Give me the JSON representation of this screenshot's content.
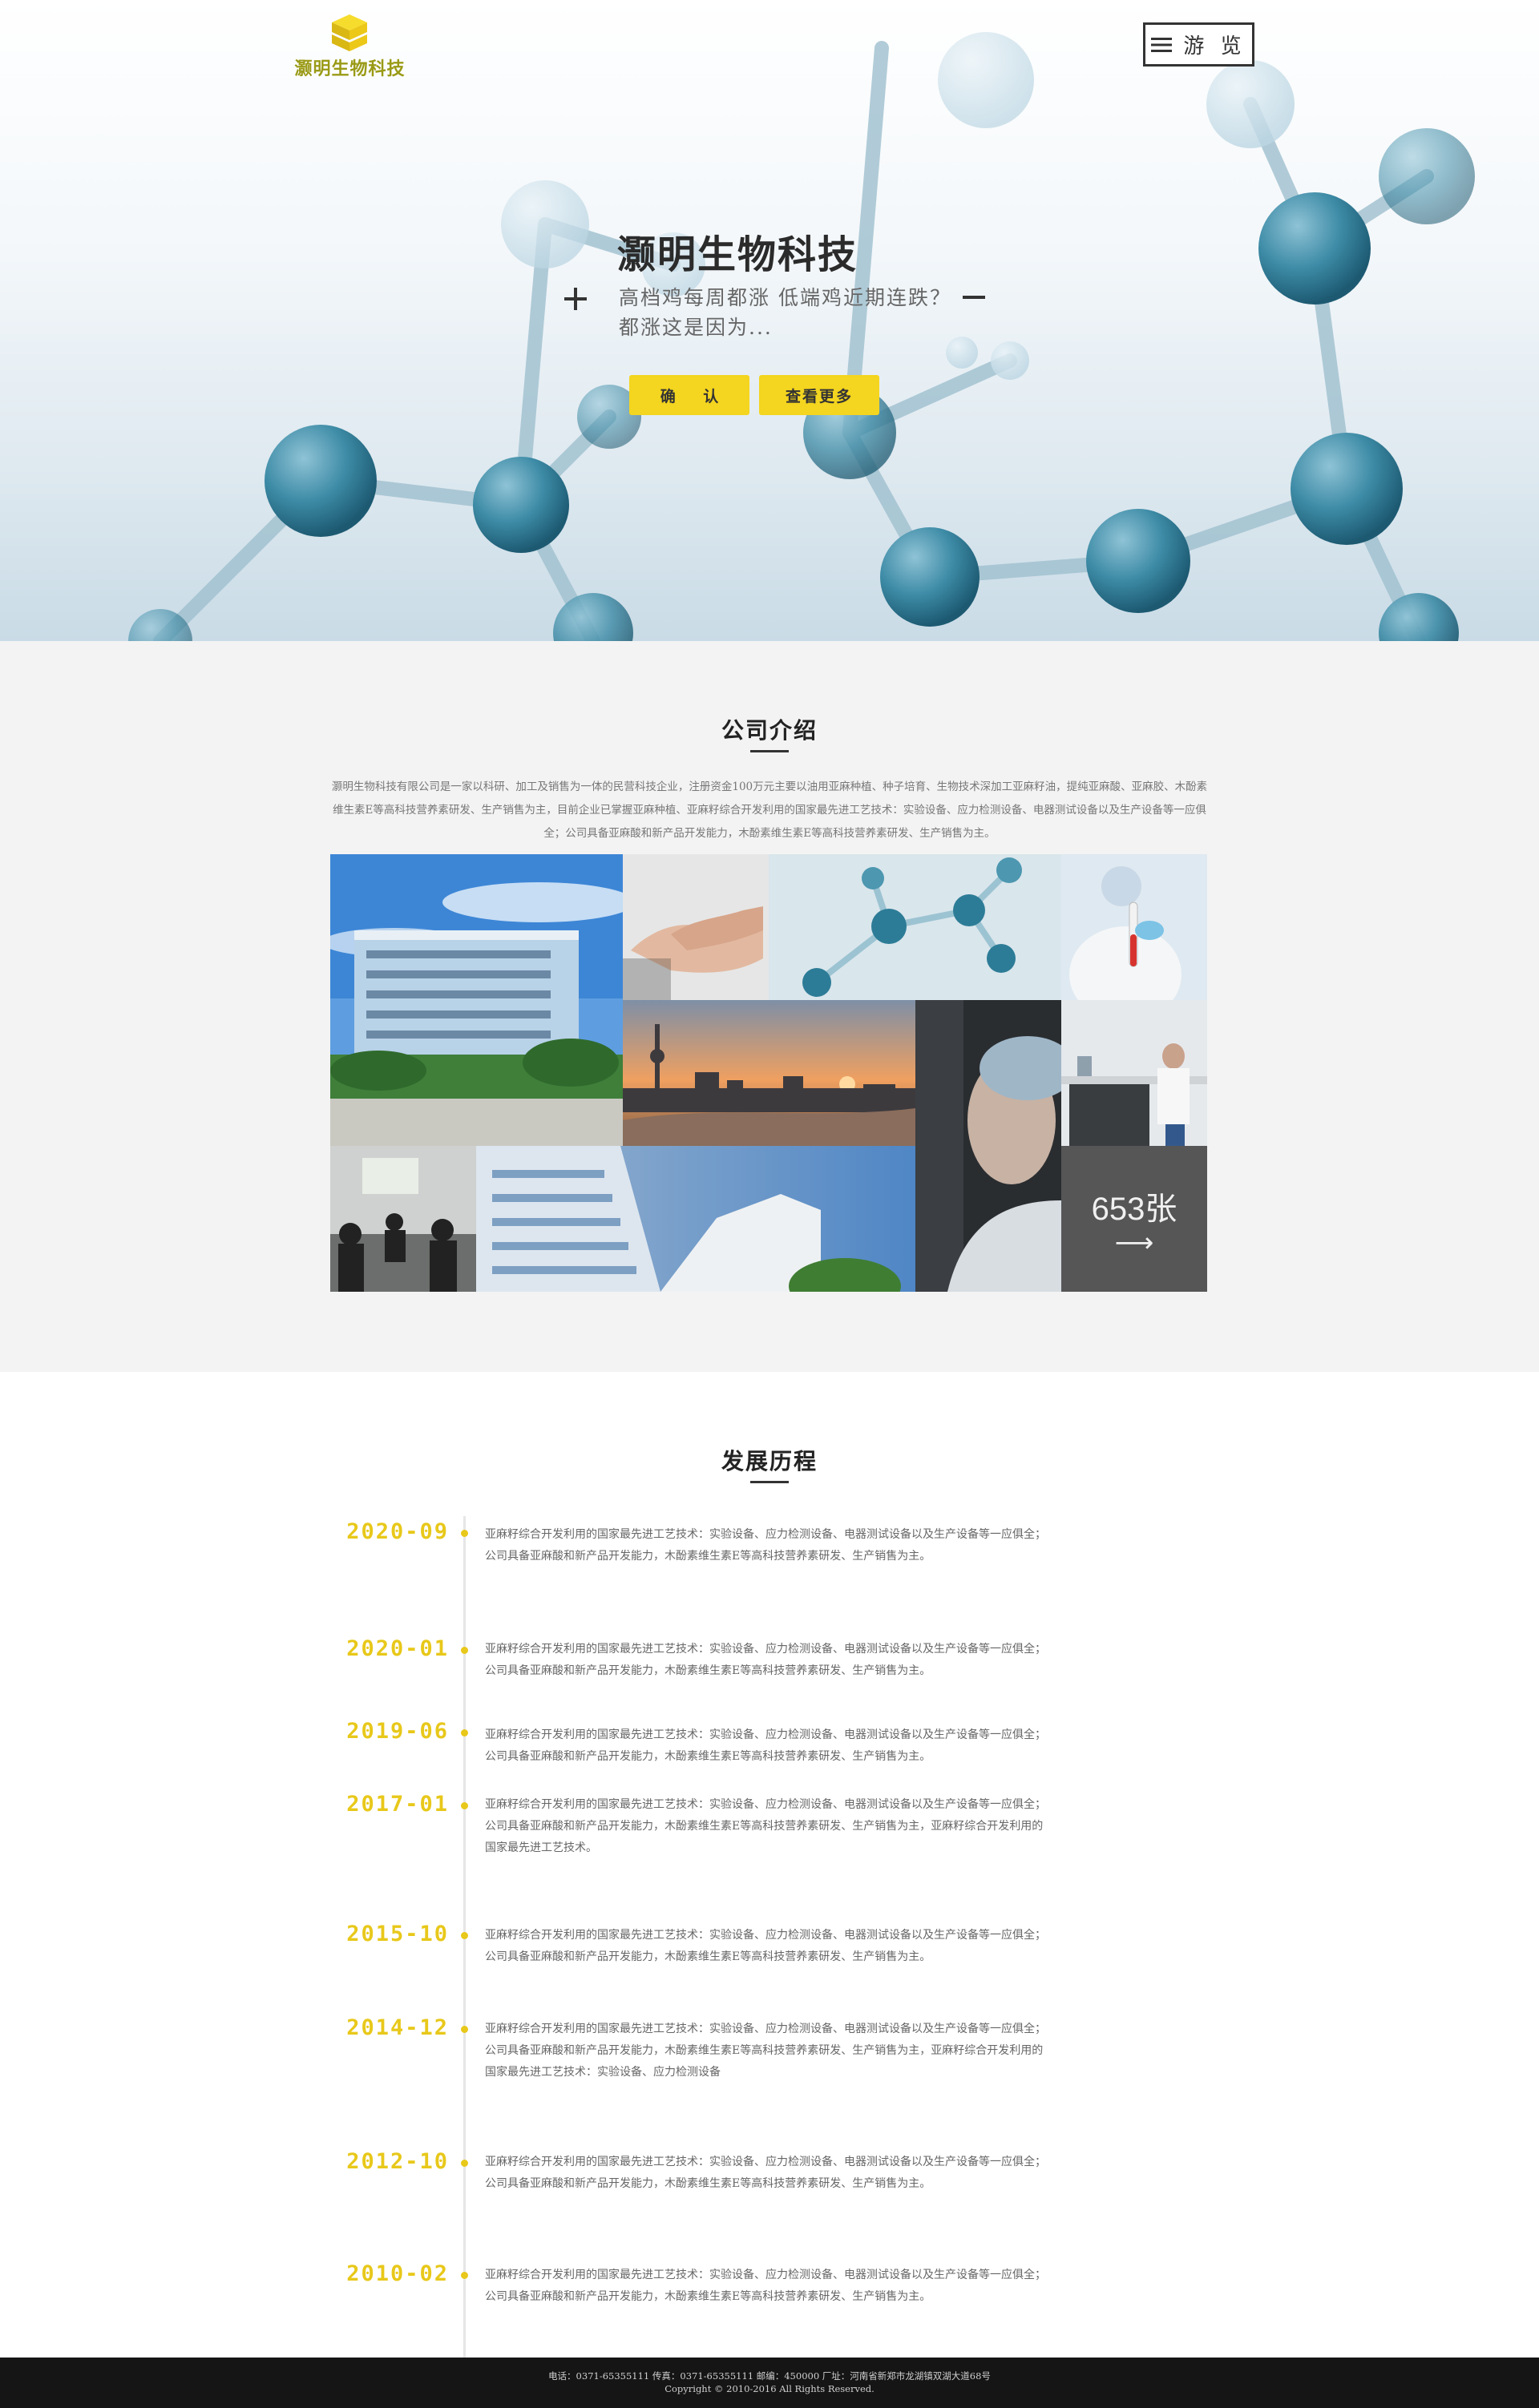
{
  "header": {
    "logo_text": "灏明生物科技",
    "menu_label": "游 览"
  },
  "hero": {
    "title": "灏明生物科技",
    "subtitle": "高档鸡每周都涨  低端鸡近期连跌？都涨这是因为...",
    "confirm_button": "确 认",
    "more_button": "查看更多"
  },
  "intro": {
    "title": "公司介绍",
    "text": "灏明生物科技有限公司是一家以科研、加工及销售为一体的民营科技企业，注册资金100万元主要以油用亚麻种植、种子培育、生物技术深加工亚麻籽油，提纯亚麻酸、亚麻胶、木酚素维生素E等高科技营养素研发、生产销售为主，目前企业已掌握亚麻种植、亚麻籽综合开发利用的国家最先进工艺技术：实验设备、应力检测设备、电器测试设备以及生产设备等一应俱全；公司具备亚麻酸和新产品开发能力，木酚素维生素E等高科技营养素研发、生产销售为主。",
    "gallery_count": "653张",
    "gallery_arrow": "⟶"
  },
  "history": {
    "title": "发展历程",
    "items": [
      {
        "year": "2020-09",
        "text": "亚麻籽综合开发利用的国家最先进工艺技术：实验设备、应力检测设备、电器测试设备以及生产设备等一应俱全；公司具备亚麻酸和新产品开发能力，木酚素维生素E等高科技营养素研发、生产销售为主。"
      },
      {
        "year": "2020-01",
        "text": "亚麻籽综合开发利用的国家最先进工艺技术：实验设备、应力检测设备、电器测试设备以及生产设备等一应俱全；公司具备亚麻酸和新产品开发能力，木酚素维生素E等高科技营养素研发、生产销售为主。"
      },
      {
        "year": "2019-06",
        "text": "亚麻籽综合开发利用的国家最先进工艺技术：实验设备、应力检测设备、电器测试设备以及生产设备等一应俱全；公司具备亚麻酸和新产品开发能力，木酚素维生素E等高科技营养素研发、生产销售为主。"
      },
      {
        "year": "2017-01",
        "text": "亚麻籽综合开发利用的国家最先进工艺技术：实验设备、应力检测设备、电器测试设备以及生产设备等一应俱全；公司具备亚麻酸和新产品开发能力，木酚素维生素E等高科技营养素研发、生产销售为主，亚麻籽综合开发利用的国家最先进工艺技术。"
      },
      {
        "year": "2015-10",
        "text": "亚麻籽综合开发利用的国家最先进工艺技术：实验设备、应力检测设备、电器测试设备以及生产设备等一应俱全；公司具备亚麻酸和新产品开发能力，木酚素维生素E等高科技营养素研发、生产销售为主。"
      },
      {
        "year": "2014-12",
        "text": "亚麻籽综合开发利用的国家最先进工艺技术：实验设备、应力检测设备、电器测试设备以及生产设备等一应俱全；公司具备亚麻酸和新产品开发能力，木酚素维生素E等高科技营养素研发、生产销售为主，亚麻籽综合开发利用的国家最先进工艺技术：实验设备、应力检测设备"
      },
      {
        "year": "2012-10",
        "text": "亚麻籽综合开发利用的国家最先进工艺技术：实验设备、应力检测设备、电器测试设备以及生产设备等一应俱全；公司具备亚麻酸和新产品开发能力，木酚素维生素E等高科技营养素研发、生产销售为主。"
      },
      {
        "year": "2010-02",
        "text": "亚麻籽综合开发利用的国家最先进工艺技术：实验设备、应力检测设备、电器测试设备以及生产设备等一应俱全；公司具备亚麻酸和新产品开发能力，木酚素维生素E等高科技营养素研发、生产销售为主。"
      }
    ]
  },
  "footer": {
    "line1": "电话：0371-65355111 传真：0371-65355111 邮编：450000 厂址：河南省新郑市龙湖镇双湖大道68号",
    "line2": "Copyright © 2010-2016 All Rights Reserved."
  },
  "colors": {
    "accent": "#f4d51f",
    "year": "#e8c81a",
    "logo": "#9a9a16",
    "footer_bg": "#151515",
    "intro_bg": "#f3f3f3"
  },
  "icons": [
    "logo-cube-icon",
    "menu-icon",
    "plus-icon",
    "minus-icon",
    "arrow-right-icon"
  ]
}
